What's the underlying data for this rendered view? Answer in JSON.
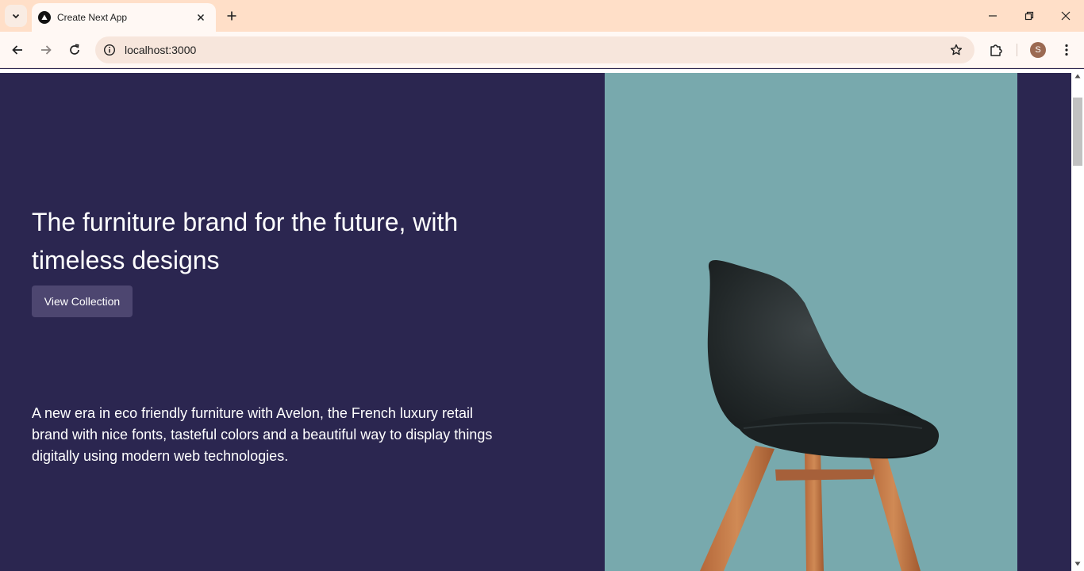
{
  "browser": {
    "tab": {
      "title": "Create Next App"
    },
    "address": {
      "url": "localhost:3000"
    },
    "profile_initial": "S",
    "theme_colors": {
      "tabstrip": "#ffdfc8",
      "toolbar": "#fff8f4",
      "omnibox": "#f7e6dc"
    }
  },
  "hero": {
    "title": "The furniture brand for the future, with timeless designs",
    "cta_label": "View Collection",
    "description": "A new era in eco friendly furniture with Avelon, the French luxury retail brand with nice fonts, tasteful colors and a beautiful way to display things digitally using modern web technologies.",
    "image_subject": "chair",
    "colors": {
      "background": "#2b2650",
      "button": "#4d4670",
      "image_backdrop": "#78a9ad"
    }
  },
  "icons": {
    "tab_search": "chevron-down-icon",
    "favicon": "triangle-logo-icon",
    "tab_close": "close-icon",
    "new_tab": "plus-icon",
    "minimize": "minimize-icon",
    "restore": "restore-icon",
    "close_window": "close-icon",
    "back": "arrow-left-icon",
    "forward": "arrow-right-icon",
    "reload": "reload-icon",
    "site_info": "info-icon",
    "bookmark": "star-icon",
    "extensions": "puzzle-icon",
    "menu": "kebab-menu-icon"
  }
}
